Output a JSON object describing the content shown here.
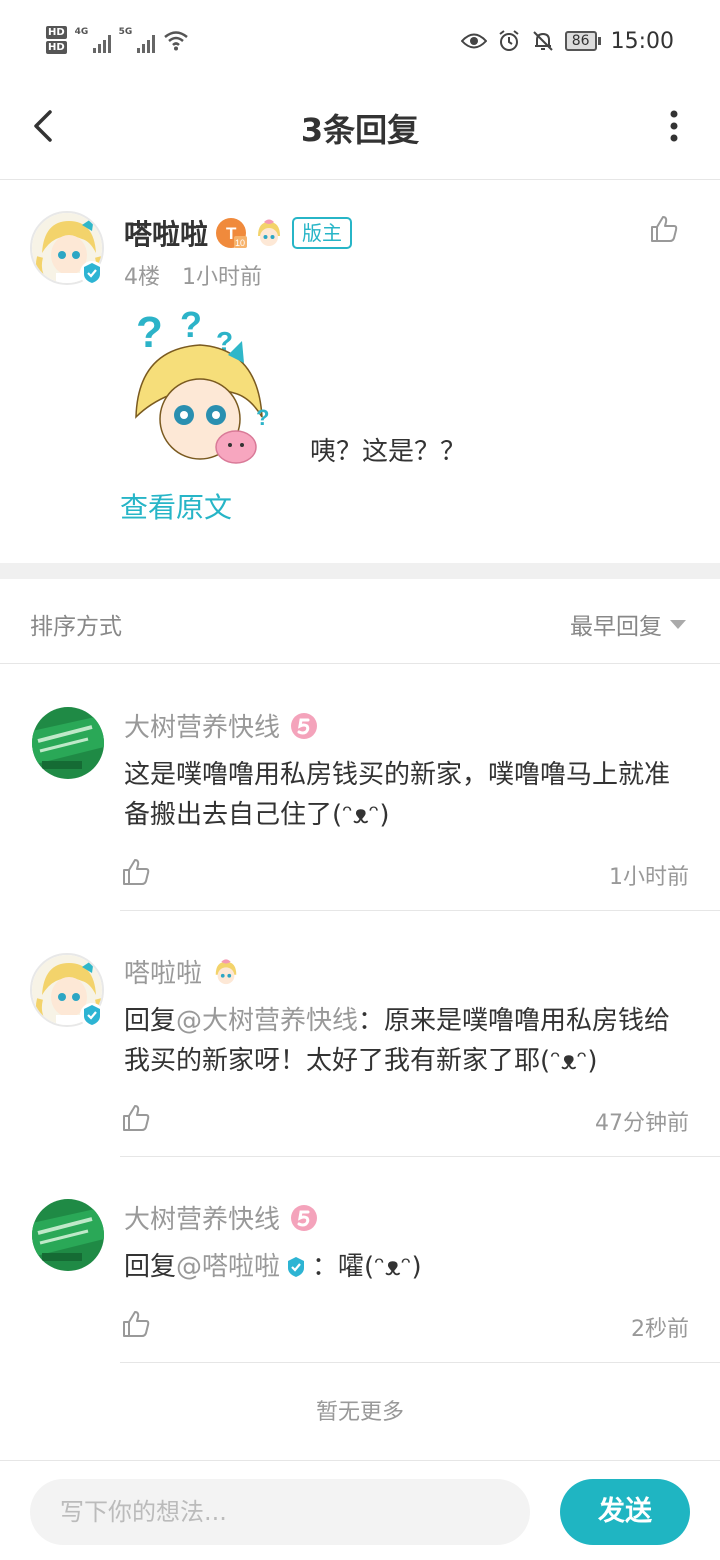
{
  "status_bar": {
    "hd1": "HD",
    "hd2": "HD",
    "net1": "4G",
    "net2": "5G",
    "battery": "86",
    "time": "15:00"
  },
  "header": {
    "title": "3条回复"
  },
  "post": {
    "author": "嗒啦啦",
    "badge_mod": "版主",
    "floor": "4楼",
    "time": "1小时前",
    "content": "咦？这是？？",
    "view_original": "查看原文"
  },
  "sort": {
    "label": "排序方式",
    "value": "最早回复"
  },
  "replies": [
    {
      "author": "大树营养快线",
      "text": "这是噗噜噜用私房钱买的新家，噗噜噜马上就准备搬出去自己住了(ᵔᴥᵔ)",
      "time": "1小时前"
    },
    {
      "author": "嗒啦啦",
      "reply_prefix": "回复",
      "mention": "@大树营养快线",
      "text": "：原来是噗噜噜用私房钱给我买的新家呀！太好了我有新家了耶(ᵔᴥᵔ)",
      "time": "47分钟前"
    },
    {
      "author": "大树营养快线",
      "reply_prefix": "回复",
      "mention": "@嗒啦啦",
      "text": "：嚯(ᵔᴥᵔ)",
      "time": "2秒前"
    }
  ],
  "no_more": "暂无更多",
  "composer": {
    "placeholder": "写下你的想法...",
    "send_label": "发送"
  },
  "colors": {
    "accent": "#27b5c7",
    "send_button": "#1fb5c2"
  }
}
